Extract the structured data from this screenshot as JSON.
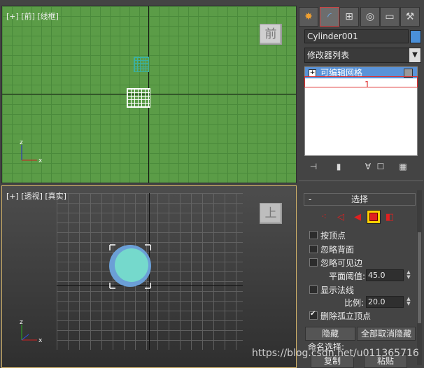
{
  "viewport_front": {
    "label": "[+] [前] [线框]",
    "nav_label": "前"
  },
  "viewport_persp": {
    "label": "[+] [透视] [真实]",
    "nav_label": "上"
  },
  "axis": {
    "x": "x",
    "z": "z"
  },
  "panel": {
    "object_name": "Cylinder001",
    "modifier_list": "修改器列表",
    "stack_item": "可编辑网格",
    "annotation": "1",
    "colors": {
      "object_color": "#4a90d9",
      "accent": "#e03030"
    }
  },
  "selection": {
    "title": "选择",
    "collapse": "-",
    "by_vertex": "按顶点",
    "ignore_backface": "忽略背面",
    "ignore_visible_edges": "忽略可见边",
    "planar_thresh_label": "平面阈值:",
    "planar_thresh_value": "45.0",
    "show_normals": "显示法线",
    "scale_label": "比例:",
    "scale_value": "20.0",
    "delete_isolated": "删除孤立顶点",
    "hide_btn": "隐藏",
    "unhide_all_btn": "全部取消隐藏",
    "named_sel_label": "命名选择:",
    "copy_btn": "复制",
    "paste_btn": "粘贴"
  },
  "watermark": "https://blog.csdn.net/u011365716"
}
